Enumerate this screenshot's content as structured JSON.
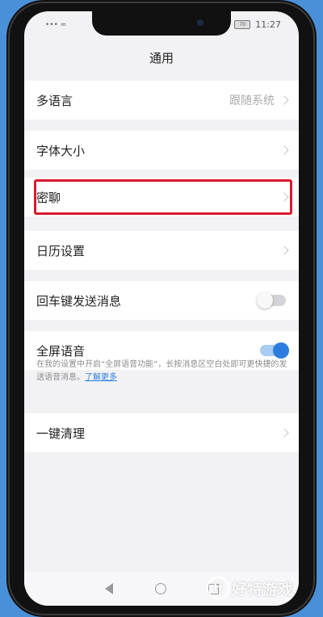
{
  "status_bar": {
    "signal": "••• ≈",
    "battery_text": "70",
    "time": "11:27"
  },
  "header": {
    "title": "通用"
  },
  "settings": {
    "language": {
      "label": "多语言",
      "value": "跟随系统"
    },
    "font_size": {
      "label": "字体大小"
    },
    "secret_chat": {
      "label": "密聊"
    },
    "calendar": {
      "label": "日历设置"
    },
    "enter_send": {
      "label": "回车键发送消息",
      "enabled": false
    },
    "fullscreen_voice": {
      "label": "全屏语音",
      "enabled": true
    },
    "fullscreen_hint": "在我的设置中开启“全屏语音功能”，长按消息区空白处即可更快捷的发送语音消息。",
    "fullscreen_hint_link": "了解更多",
    "clear": {
      "label": "一键清理"
    }
  },
  "watermark": {
    "logo": "H",
    "text": "好特游戏"
  },
  "colors": {
    "highlight_border": "#d9192c",
    "accent": "#2d7de0",
    "background": "#4a90d9"
  }
}
